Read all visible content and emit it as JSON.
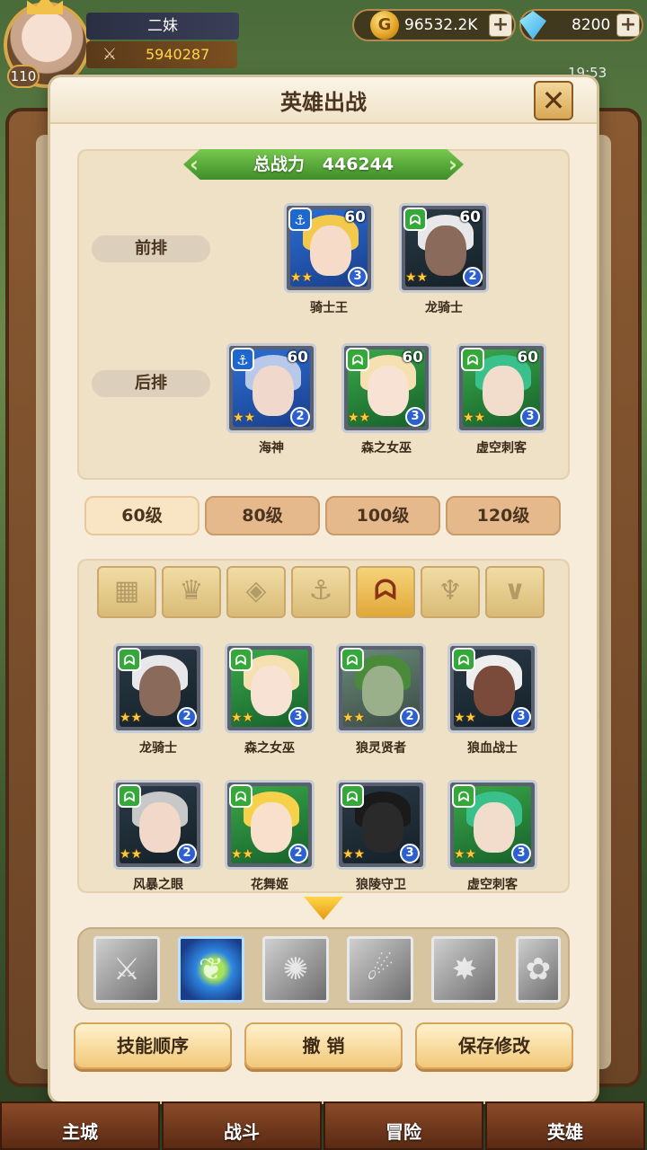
{
  "hud": {
    "player_name": "二妹",
    "player_level": "110",
    "player_power": "5940287",
    "gold": "96532.2K",
    "gems": "8200",
    "time": "19:53"
  },
  "modal": {
    "title": "英雄出战",
    "close_icon": "close-icon",
    "total_power_label": "总战力",
    "total_power_value": "446244",
    "front_row_label": "前排",
    "back_row_label": "后排",
    "front_row": [
      {
        "name": "骑士王",
        "level": "60",
        "stars": "3",
        "faction": "anchor"
      },
      {
        "name": "龙骑士",
        "level": "60",
        "stars": "2",
        "faction": "beast"
      }
    ],
    "back_row": [
      {
        "name": "海神",
        "level": "60",
        "stars": "2",
        "faction": "anchor"
      },
      {
        "name": "森之女巫",
        "level": "60",
        "stars": "3",
        "faction": "beast"
      },
      {
        "name": "虚空刺客",
        "level": "60",
        "stars": "3",
        "faction": "beast"
      }
    ],
    "level_tabs": [
      "60级",
      "80级",
      "100级",
      "120级"
    ],
    "active_level_tab": 0,
    "filters": [
      "all-grid-icon",
      "class-crown-icon",
      "class-diamond-icon",
      "anchor-icon",
      "beast-icon",
      "horned-icon",
      "v-icon"
    ],
    "active_filter": 4,
    "roster": [
      {
        "name": "龙骑士",
        "stars": "2"
      },
      {
        "name": "森之女巫",
        "stars": "3"
      },
      {
        "name": "狼灵贤者",
        "stars": "2"
      },
      {
        "name": "狼血战士",
        "stars": "3"
      },
      {
        "name": "风暴之眼",
        "stars": "2"
      },
      {
        "name": "花舞姬",
        "stars": "2"
      },
      {
        "name": "狼陵守卫",
        "stars": "3"
      },
      {
        "name": "虚空刺客",
        "stars": "3"
      }
    ],
    "buttons": {
      "skill_order": "技能顺序",
      "undo": "撤 销",
      "save": "保存修改"
    }
  },
  "nav": {
    "tabs": [
      "主城",
      "战斗",
      "冒险",
      "英雄"
    ],
    "active": 3
  }
}
